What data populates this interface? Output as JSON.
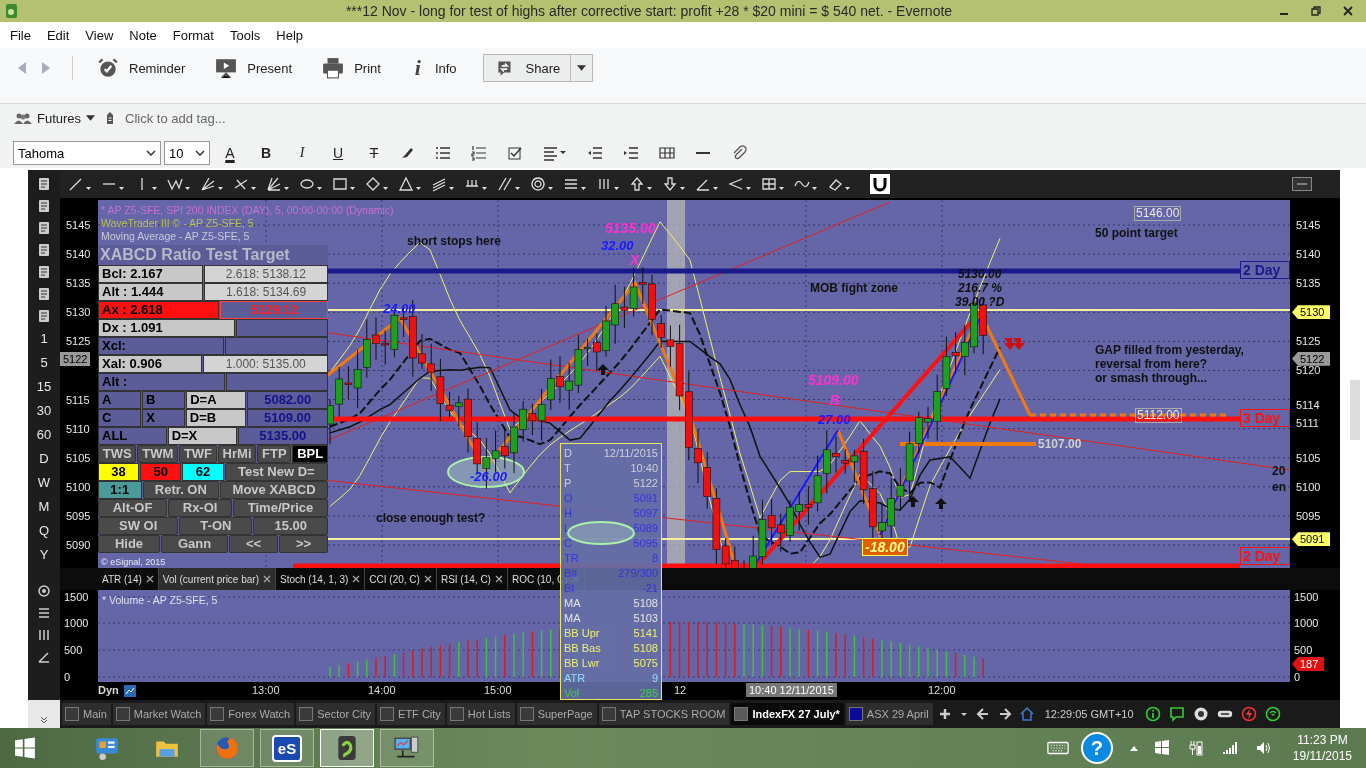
{
  "window": {
    "title": "***12 Nov - long for test of highs after corrective start: profit +28 * $20 mini = $ 540 net. - Evernote"
  },
  "menu": [
    "File",
    "Edit",
    "View",
    "Note",
    "Format",
    "Tools",
    "Help"
  ],
  "toolbar": [
    {
      "kind": "reminder",
      "label": "Reminder"
    },
    {
      "kind": "present",
      "label": "Present"
    },
    {
      "kind": "print",
      "label": "Print"
    },
    {
      "kind": "info",
      "label": "Info",
      "glyph": "i"
    },
    {
      "kind": "share",
      "label": "Share"
    }
  ],
  "tag_row": {
    "notebook": "Futures",
    "placeholder": "Click to add tag..."
  },
  "format_bar": {
    "font": "Tahoma",
    "size": "10",
    "buttons": [
      {
        "kind": "color",
        "glyph": "A"
      },
      {
        "kind": "bold",
        "glyph": "B"
      },
      {
        "kind": "italic",
        "glyph": "I"
      },
      {
        "kind": "underline",
        "glyph": "U"
      },
      {
        "kind": "strike",
        "glyph": "T"
      },
      {
        "kind": "highlight"
      },
      {
        "kind": "bullets"
      },
      {
        "kind": "numbers"
      },
      {
        "kind": "checkbox"
      },
      {
        "kind": "align"
      },
      {
        "kind": "outdent"
      },
      {
        "kind": "indent"
      },
      {
        "kind": "table"
      },
      {
        "kind": "rule"
      },
      {
        "kind": "attach"
      }
    ]
  },
  "chart": {
    "intervals": [
      "1",
      "5",
      "15",
      "30",
      "60",
      "D",
      "W",
      "M",
      "Q",
      "Y"
    ],
    "legend": [
      {
        "text": "* AP Z5-SFE, SPI 200 INDEX (DAY), 5, 00:00-00:00 (Dynamic)",
        "color": "#c86fd8"
      },
      {
        "text": "WaveTrader III © - AP Z5-SFE, 5",
        "color": "#b9c24a"
      },
      {
        "text": "Moving Average - AP Z5-SFE, 5",
        "color": "#c8c8d8"
      }
    ],
    "copyright": "© eSignal, 2015",
    "annotations": [
      {
        "text": "short stops here",
        "kind": "note"
      },
      {
        "text": "5135.00",
        "kind": "magenta"
      },
      {
        "text": "X",
        "kind": "magenta"
      },
      {
        "text": "32.00",
        "kind": "blue"
      },
      {
        "text": "5146.00",
        "kind": "pricebox"
      },
      {
        "text": "50 point target",
        "kind": "note"
      },
      {
        "text": "24.00",
        "kind": "blue"
      },
      {
        "text": "MOB fight zone",
        "kind": "note"
      },
      {
        "text": "5130.00",
        "kind": "italic"
      },
      {
        "text": "216.7 %",
        "kind": "italic"
      },
      {
        "text": "39.00 ?D",
        "kind": "italic"
      },
      {
        "text": "5109.00",
        "kind": "magenta"
      },
      {
        "text": "GAP filled from yesterday,\nreversal from here?\nor smash through...",
        "kind": "note"
      },
      {
        "text": "B",
        "kind": "magenta"
      },
      {
        "text": "27.00",
        "kind": "blue"
      },
      {
        "text": "5112.00",
        "kind": "pricebox"
      },
      {
        "text": "5107.00",
        "kind": "grey"
      },
      {
        "text": "-26.00",
        "kind": "blue"
      },
      {
        "text": "20",
        "kind": "note"
      },
      {
        "text": "en",
        "kind": "note"
      },
      {
        "text": "close enough test?",
        "kind": "note"
      },
      {
        "text": "-18.00",
        "kind": "tag"
      }
    ],
    "levels": [
      {
        "label": "2 Day",
        "color": "#1a1a8a"
      },
      {
        "label": "3 Day",
        "color": "#ff1010"
      },
      {
        "label": "2 Day",
        "color": "#ff1010"
      }
    ],
    "left_axis": [
      "5145",
      "5140",
      "5135",
      "5130",
      "5125",
      "5115",
      "5110",
      "5105",
      "5100",
      "5095",
      "5090"
    ],
    "left_markers": [
      {
        "label": "5122",
        "color": "#9a9a9a"
      }
    ],
    "right_axis": [
      "5145",
      "5140",
      "5135",
      "5125",
      "5120",
      "5114",
      "5111",
      "5105",
      "5100",
      "5095"
    ],
    "right_markers": [
      {
        "label": "5130",
        "color": "#ffff66"
      },
      {
        "label": "5122",
        "color": "#9a9a9a"
      },
      {
        "label": "5091",
        "color": "#ffff66"
      }
    ],
    "panel": {
      "title": "XABCD Ratio Test Target",
      "rows": [
        [
          {
            "text": "Bcl:  2.167",
            "kind": "label"
          },
          {
            "text": "2.618: 5138.12",
            "kind": "ghost"
          }
        ],
        [
          {
            "text": "Alt :  1.444",
            "kind": "label"
          },
          {
            "text": "1.618: 5134.69",
            "kind": "ghost"
          }
        ],
        [
          {
            "text": "Ax :  2.618",
            "kind": "alert"
          },
          {
            "text": "5129.12",
            "kind": "alert-value"
          }
        ],
        [
          {
            "text": "Dx :  1.091",
            "kind": "label"
          },
          {
            "text": "",
            "kind": "empty"
          }
        ],
        [
          {
            "text": "Xcl:",
            "kind": "dim"
          },
          {
            "text": "",
            "kind": "empty"
          }
        ],
        [
          {
            "text": "Xal: 0.906",
            "kind": "label"
          },
          {
            "text": "1.000: 5135.00",
            "kind": "ghost"
          }
        ],
        [
          {
            "text": "Alt :",
            "kind": "dim"
          },
          {
            "text": "",
            "kind": "empty"
          }
        ],
        [
          {
            "text": "A",
            "kind": "dim"
          },
          {
            "text": "B",
            "kind": "dim"
          },
          {
            "text": "D=A",
            "kind": "label"
          },
          {
            "text": "5082.00",
            "kind": "value"
          }
        ],
        [
          {
            "text": "C",
            "kind": "dim"
          },
          {
            "text": "X",
            "kind": "dim"
          },
          {
            "text": "D=B",
            "kind": "label"
          },
          {
            "text": "5109.00",
            "kind": "value"
          }
        ],
        [
          {
            "text": "ALL",
            "kind": "dim"
          },
          {
            "text": "D=X",
            "kind": "label"
          },
          {
            "text": "5135.00",
            "kind": "value"
          }
        ],
        [
          {
            "text": "TWS",
            "kind": "button"
          },
          {
            "text": "TWM",
            "kind": "button"
          },
          {
            "text": "TWF",
            "kind": "button"
          },
          {
            "text": "HrMi",
            "kind": "button"
          },
          {
            "text": "FTP",
            "kind": "button"
          },
          {
            "text": "BPL",
            "kind": "dark"
          }
        ],
        [
          {
            "text": "38",
            "kind": "colored",
            "color": "#ffff00"
          },
          {
            "text": "50",
            "kind": "colored",
            "color": "#ff1010"
          },
          {
            "text": "62",
            "kind": "colored",
            "color": "#00ffff"
          },
          {
            "text": "Test New D=",
            "kind": "button"
          }
        ],
        [
          {
            "text": "1:1",
            "kind": "colored",
            "color": "#4a9a9a"
          },
          {
            "text": "Retr. ON",
            "kind": "button"
          },
          {
            "text": "Move XABCD",
            "kind": "button"
          }
        ],
        [
          {
            "text": "Alt-OF",
            "kind": "button"
          },
          {
            "text": "Rx-OI",
            "kind": "button"
          },
          {
            "text": "Time/Price",
            "kind": "button"
          }
        ],
        [
          {
            "text": "SW OI",
            "kind": "button"
          },
          {
            "text": "T-ON",
            "kind": "button"
          },
          {
            "text": "15.00",
            "kind": "button"
          }
        ],
        [
          {
            "text": "Hide",
            "kind": "button"
          },
          {
            "text": "Gann",
            "kind": "button"
          },
          {
            "text": "<<",
            "kind": "button"
          },
          {
            "text": ">>",
            "kind": "button"
          }
        ]
      ]
    },
    "indicator_tabs": [
      {
        "label": "ATR (14)",
        "selected": false
      },
      {
        "label": "Vol (current price bar)",
        "selected": true
      },
      {
        "label": "Stoch (14, 1, 3)",
        "selected": false
      },
      {
        "label": "CCI (20, C)",
        "selected": false
      },
      {
        "label": "RSI (14, C)",
        "selected": false
      },
      {
        "label": "ROC (10, C)",
        "selected": false
      }
    ],
    "volume": {
      "legend": "* Volume - AP Z5-SFE, 5",
      "axis": [
        "1500",
        "1000",
        "500",
        "0"
      ],
      "right_axis": [
        "1500",
        "1000",
        "500",
        "0"
      ],
      "marker": {
        "label": "187",
        "color": "#e01010"
      }
    },
    "time_axis": {
      "mode": "Dyn",
      "labels": [
        "13:00",
        "14:00",
        "15:00",
        "12",
        "12:00"
      ],
      "cursor": "10:40 12/11/2015"
    },
    "data_window": [
      {
        "label": "D",
        "value": "12/11/2015",
        "color": "#d0d0d8"
      },
      {
        "label": "T",
        "value": "10:40",
        "color": "#d0d0d8"
      },
      {
        "label": "P",
        "value": "5122",
        "color": "#d0d0d8"
      },
      {
        "label": "O",
        "value": "5091",
        "color": "#3434d8"
      },
      {
        "label": "H",
        "value": "5097",
        "color": "#3434d8"
      },
      {
        "label": "L",
        "value": "5089",
        "color": "#3434d8"
      },
      {
        "label": "C",
        "value": "5095",
        "color": "#3434d8"
      },
      {
        "label": "TR",
        "value": "8",
        "color": "#3434d8"
      },
      {
        "label": "B#",
        "value": "279/300",
        "color": "#3434d8"
      },
      {
        "label": "BI",
        "value": "-21",
        "color": "#3434d8"
      },
      {
        "label": "MA",
        "value": "5108",
        "color": "#e4e4e4"
      },
      {
        "label": "MA",
        "value": "5103",
        "color": "#e4e4e4"
      },
      {
        "label": "BB Upr",
        "value": "5141",
        "color": "#f0f070"
      },
      {
        "label": "BB Bas",
        "value": "5108",
        "color": "#f0f070"
      },
      {
        "label": "BB Lwr",
        "value": "5075",
        "color": "#f0f070"
      },
      {
        "label": "ATR",
        "value": "9",
        "color": "#8ee0ff"
      },
      {
        "label": "Vol",
        "value": "285",
        "color": "#40d040"
      }
    ]
  },
  "workspace_tabs": [
    {
      "label": "Main",
      "selected": false,
      "color": "#3a3a3a"
    },
    {
      "label": "Market Watch",
      "selected": false,
      "color": "#3a3a3a"
    },
    {
      "label": "Forex Watch",
      "selected": false,
      "color": "#3a3a3a"
    },
    {
      "label": "Sector City",
      "selected": false,
      "color": "#3a3a3a"
    },
    {
      "label": "ETF City",
      "selected": false,
      "color": "#3a3a3a"
    },
    {
      "label": "Hot Lists",
      "selected": false,
      "color": "#3a3a3a"
    },
    {
      "label": "SuperPage",
      "selected": false,
      "color": "#3a3a3a"
    },
    {
      "label": "TAP STOCKS ROOM",
      "selected": false,
      "color": "#3a3a3a"
    },
    {
      "label": "IndexFX 27 July*",
      "selected": true,
      "color": "#5a5a5a"
    },
    {
      "label": "ASX 29 April",
      "selected": false,
      "color": "#0a0a9a"
    }
  ],
  "status": {
    "clock": "12:29:05 GMT+10"
  },
  "taskbar": {
    "apps": [
      {
        "kind": "panel",
        "running": false,
        "selected": false
      },
      {
        "kind": "folder",
        "running": false,
        "selected": false
      },
      {
        "kind": "firefox",
        "running": true,
        "selected": false
      },
      {
        "kind": "esignal",
        "glyph": "eS",
        "running": true,
        "selected": false
      },
      {
        "kind": "evernote",
        "running": true,
        "selected": true
      },
      {
        "kind": "network",
        "running": true,
        "selected": false
      }
    ],
    "help": "?",
    "time": "11:23 PM",
    "date": "19/11/2015"
  }
}
